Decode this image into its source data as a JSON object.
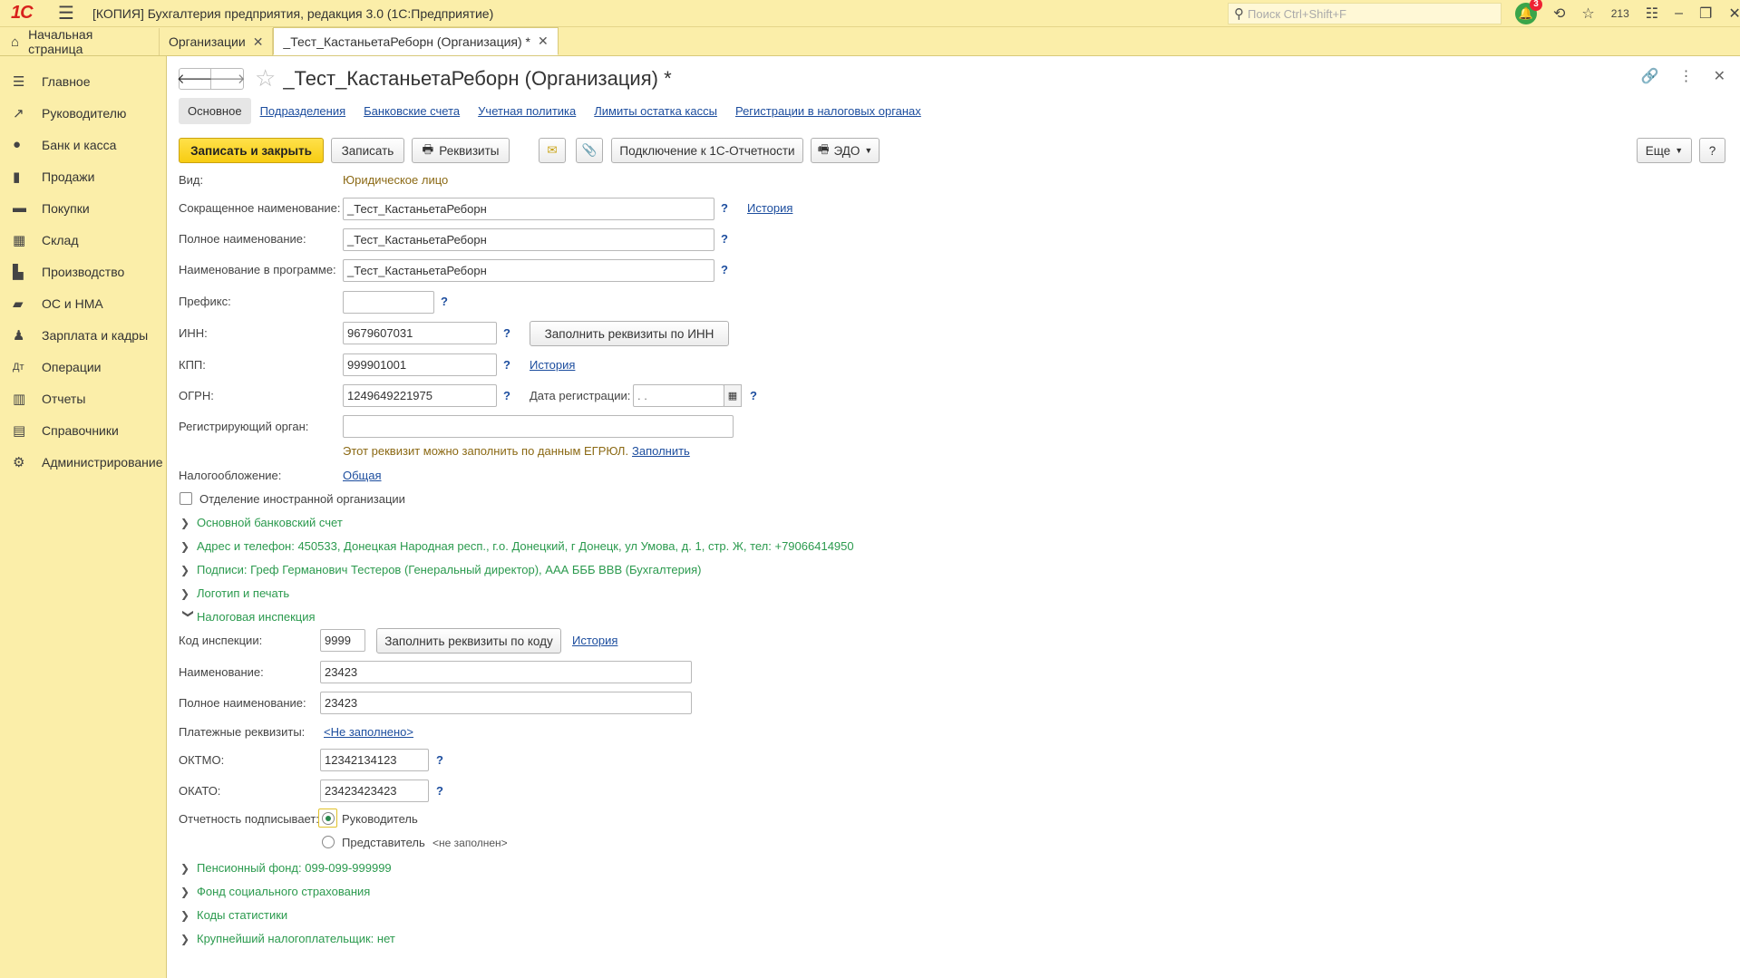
{
  "app": {
    "logo": "1С",
    "title": "[КОПИЯ] Бухгалтерия предприятия, редакция 3.0  (1С:Предприятие)",
    "search_placeholder": "Поиск Ctrl+Shift+F",
    "notifications_count": "3",
    "favorites_count": "213"
  },
  "tabs": [
    {
      "label": "Начальная страница"
    },
    {
      "label": "Организации"
    },
    {
      "label": "_Тест_КастаньетаРеборн (Организация) *"
    }
  ],
  "sidebar": {
    "items": [
      {
        "label": "Главное",
        "icon": "menu-icon"
      },
      {
        "label": "Руководителю",
        "icon": "trend-icon"
      },
      {
        "label": "Банк и касса",
        "icon": "coin-icon"
      },
      {
        "label": "Продажи",
        "icon": "bag-icon"
      },
      {
        "label": "Покупки",
        "icon": "cart-icon"
      },
      {
        "label": "Склад",
        "icon": "warehouse-icon"
      },
      {
        "label": "Производство",
        "icon": "factory-icon"
      },
      {
        "label": "ОС и НМА",
        "icon": "truck-icon"
      },
      {
        "label": "Зарплата и кадры",
        "icon": "person-icon"
      },
      {
        "label": "Операции",
        "icon": "operations-icon"
      },
      {
        "label": "Отчеты",
        "icon": "bar-chart-icon"
      },
      {
        "label": "Справочники",
        "icon": "book-icon"
      },
      {
        "label": "Администрирование",
        "icon": "gear-icon"
      }
    ]
  },
  "form": {
    "title": "_Тест_КастаньетаРеборн (Организация) *",
    "subtabs": [
      "Основное",
      "Подразделения",
      "Банковские счета",
      "Учетная политика",
      "Лимиты остатка кассы",
      "Регистрации в налоговых органах"
    ],
    "toolbar": {
      "save_close": "Записать и закрыть",
      "save": "Записать",
      "requisites": "Реквизиты",
      "connect": "Подключение к 1С-Отчетности",
      "edo": "ЭДО",
      "more": "Еще",
      "help": "?"
    },
    "kind_label": "Вид:",
    "kind_value": "Юридическое лицо",
    "short_name_label": "Сокращенное наименование:",
    "short_name": "_Тест_КастаньетаРеборн",
    "history": "История",
    "full_name_label": "Полное наименование:",
    "full_name": "_Тест_КастаньетаРеборн",
    "prog_name_label": "Наименование в программе:",
    "prog_name": "_Тест_КастаньетаРеборн",
    "prefix_label": "Префикс:",
    "prefix": "",
    "inn_label": "ИНН:",
    "inn": "9679607031",
    "fill_by_inn": "Заполнить реквизиты по ИНН",
    "kpp_label": "КПП:",
    "kpp": "999901001",
    "ogrn_label": "ОГРН:",
    "ogrn": "1249649221975",
    "reg_date_label": "Дата регистрации:",
    "reg_date": " .  .",
    "reg_org_label": "Регистрирующий орган:",
    "reg_org": "",
    "egrul_note": "Этот реквизит можно заполнить по данным ЕГРЮЛ.",
    "egrul_fill": "Заполнить",
    "tax_label": "Налогообложение:",
    "tax_value": "Общая",
    "foreign_branch": "Отделение иностранной организации",
    "help_q": "?",
    "groups_top": [
      "Основной банковский счет",
      "Адрес и телефон: 450533, Донецкая Народная респ., г.о. Донецкий, г Донецк, ул Умова, д. 1, стр. Ж, тел: +79066414950",
      "Подписи: Греф Германович Тестеров (Генеральный директор), ААА БББ ВВВ (Бухгалтерия)",
      "Логотип и печать",
      "Налоговая инспекция"
    ],
    "tax_office": {
      "code_label": "Код инспекции:",
      "code": "9999",
      "fill_by_code": "Заполнить реквизиты по коду",
      "history": "История",
      "name_label": "Наименование:",
      "name": "23423",
      "full_name_label": "Полное наименование:",
      "full_name": "23423",
      "payment_label": "Платежные реквизиты:",
      "payment_value": "<Не заполнено>",
      "oktmo_label": "ОКТМО:",
      "oktmo": "12342134123",
      "okato_label": "ОКАТО:",
      "okato": "23423423423",
      "signer_label": "Отчетность подписывает:",
      "signer_head": "Руководитель",
      "signer_rep": "Представитель",
      "signer_rep_value": "<не заполнен>"
    },
    "groups_bottom": [
      "Пенсионный фонд: 099-099-999999",
      "Фонд социального страхования",
      "Коды статистики",
      "Крупнейший налогоплательщик: нет"
    ]
  }
}
